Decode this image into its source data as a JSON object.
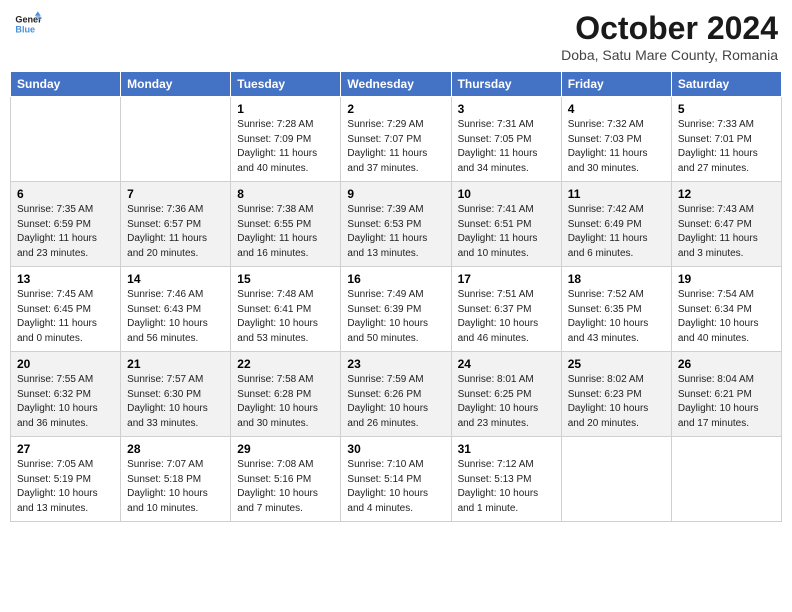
{
  "header": {
    "logo_line1": "General",
    "logo_line2": "Blue",
    "month": "October 2024",
    "location": "Doba, Satu Mare County, Romania"
  },
  "days_of_week": [
    "Sunday",
    "Monday",
    "Tuesday",
    "Wednesday",
    "Thursday",
    "Friday",
    "Saturday"
  ],
  "weeks": [
    [
      {
        "day": "",
        "info": ""
      },
      {
        "day": "",
        "info": ""
      },
      {
        "day": "1",
        "info": "Sunrise: 7:28 AM\nSunset: 7:09 PM\nDaylight: 11 hours and 40 minutes."
      },
      {
        "day": "2",
        "info": "Sunrise: 7:29 AM\nSunset: 7:07 PM\nDaylight: 11 hours and 37 minutes."
      },
      {
        "day": "3",
        "info": "Sunrise: 7:31 AM\nSunset: 7:05 PM\nDaylight: 11 hours and 34 minutes."
      },
      {
        "day": "4",
        "info": "Sunrise: 7:32 AM\nSunset: 7:03 PM\nDaylight: 11 hours and 30 minutes."
      },
      {
        "day": "5",
        "info": "Sunrise: 7:33 AM\nSunset: 7:01 PM\nDaylight: 11 hours and 27 minutes."
      }
    ],
    [
      {
        "day": "6",
        "info": "Sunrise: 7:35 AM\nSunset: 6:59 PM\nDaylight: 11 hours and 23 minutes."
      },
      {
        "day": "7",
        "info": "Sunrise: 7:36 AM\nSunset: 6:57 PM\nDaylight: 11 hours and 20 minutes."
      },
      {
        "day": "8",
        "info": "Sunrise: 7:38 AM\nSunset: 6:55 PM\nDaylight: 11 hours and 16 minutes."
      },
      {
        "day": "9",
        "info": "Sunrise: 7:39 AM\nSunset: 6:53 PM\nDaylight: 11 hours and 13 minutes."
      },
      {
        "day": "10",
        "info": "Sunrise: 7:41 AM\nSunset: 6:51 PM\nDaylight: 11 hours and 10 minutes."
      },
      {
        "day": "11",
        "info": "Sunrise: 7:42 AM\nSunset: 6:49 PM\nDaylight: 11 hours and 6 minutes."
      },
      {
        "day": "12",
        "info": "Sunrise: 7:43 AM\nSunset: 6:47 PM\nDaylight: 11 hours and 3 minutes."
      }
    ],
    [
      {
        "day": "13",
        "info": "Sunrise: 7:45 AM\nSunset: 6:45 PM\nDaylight: 11 hours and 0 minutes."
      },
      {
        "day": "14",
        "info": "Sunrise: 7:46 AM\nSunset: 6:43 PM\nDaylight: 10 hours and 56 minutes."
      },
      {
        "day": "15",
        "info": "Sunrise: 7:48 AM\nSunset: 6:41 PM\nDaylight: 10 hours and 53 minutes."
      },
      {
        "day": "16",
        "info": "Sunrise: 7:49 AM\nSunset: 6:39 PM\nDaylight: 10 hours and 50 minutes."
      },
      {
        "day": "17",
        "info": "Sunrise: 7:51 AM\nSunset: 6:37 PM\nDaylight: 10 hours and 46 minutes."
      },
      {
        "day": "18",
        "info": "Sunrise: 7:52 AM\nSunset: 6:35 PM\nDaylight: 10 hours and 43 minutes."
      },
      {
        "day": "19",
        "info": "Sunrise: 7:54 AM\nSunset: 6:34 PM\nDaylight: 10 hours and 40 minutes."
      }
    ],
    [
      {
        "day": "20",
        "info": "Sunrise: 7:55 AM\nSunset: 6:32 PM\nDaylight: 10 hours and 36 minutes."
      },
      {
        "day": "21",
        "info": "Sunrise: 7:57 AM\nSunset: 6:30 PM\nDaylight: 10 hours and 33 minutes."
      },
      {
        "day": "22",
        "info": "Sunrise: 7:58 AM\nSunset: 6:28 PM\nDaylight: 10 hours and 30 minutes."
      },
      {
        "day": "23",
        "info": "Sunrise: 7:59 AM\nSunset: 6:26 PM\nDaylight: 10 hours and 26 minutes."
      },
      {
        "day": "24",
        "info": "Sunrise: 8:01 AM\nSunset: 6:25 PM\nDaylight: 10 hours and 23 minutes."
      },
      {
        "day": "25",
        "info": "Sunrise: 8:02 AM\nSunset: 6:23 PM\nDaylight: 10 hours and 20 minutes."
      },
      {
        "day": "26",
        "info": "Sunrise: 8:04 AM\nSunset: 6:21 PM\nDaylight: 10 hours and 17 minutes."
      }
    ],
    [
      {
        "day": "27",
        "info": "Sunrise: 7:05 AM\nSunset: 5:19 PM\nDaylight: 10 hours and 13 minutes."
      },
      {
        "day": "28",
        "info": "Sunrise: 7:07 AM\nSunset: 5:18 PM\nDaylight: 10 hours and 10 minutes."
      },
      {
        "day": "29",
        "info": "Sunrise: 7:08 AM\nSunset: 5:16 PM\nDaylight: 10 hours and 7 minutes."
      },
      {
        "day": "30",
        "info": "Sunrise: 7:10 AM\nSunset: 5:14 PM\nDaylight: 10 hours and 4 minutes."
      },
      {
        "day": "31",
        "info": "Sunrise: 7:12 AM\nSunset: 5:13 PM\nDaylight: 10 hours and 1 minute."
      },
      {
        "day": "",
        "info": ""
      },
      {
        "day": "",
        "info": ""
      }
    ]
  ]
}
